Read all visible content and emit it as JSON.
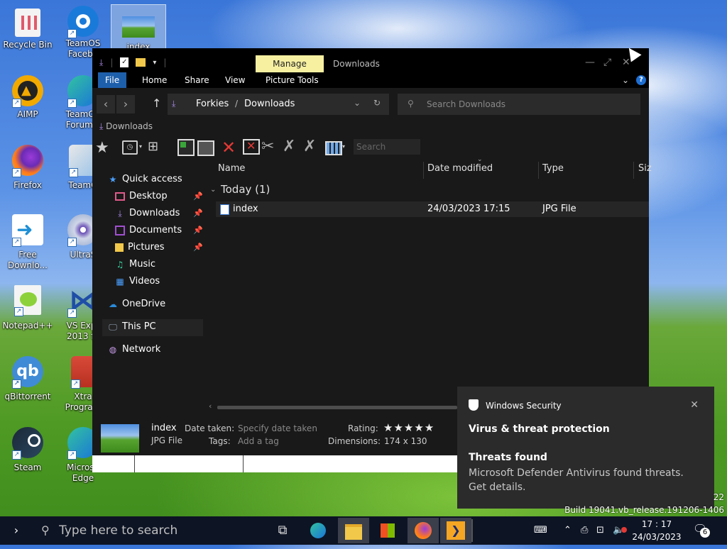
{
  "desktop": {
    "icons": [
      {
        "label": "Recycle Bin"
      },
      {
        "label": "TeamOS Facebo"
      },
      {
        "label": "index"
      },
      {
        "label": "AIMP"
      },
      {
        "label": "TeamOS Forum L"
      },
      {
        "label": "Firefox"
      },
      {
        "label": "TeamO"
      },
      {
        "label": "Free Downlo..."
      },
      {
        "label": "UltraS"
      },
      {
        "label": "Notepad++"
      },
      {
        "label": "VS Expr 2013 fo"
      },
      {
        "label": "qBittorrent"
      },
      {
        "label": "Xtra Program"
      },
      {
        "label": "Steam"
      },
      {
        "label": "Microso Edge"
      }
    ]
  },
  "explorer": {
    "manage_tab": "Manage",
    "title": "Downloads",
    "ribbon_tabs": [
      "File",
      "Home",
      "Share",
      "View",
      "Picture Tools"
    ],
    "breadcrumb": [
      "Forkies",
      "Downloads"
    ],
    "search_placeholder": "Search Downloads",
    "location_label": "Downloads",
    "toolbar_search_placeholder": "Search",
    "nav": {
      "quick_access": "Quick access",
      "items": [
        "Desktop",
        "Downloads",
        "Documents",
        "Pictures",
        "Music",
        "Videos"
      ],
      "onedrive": "OneDrive",
      "this_pc": "This PC",
      "network": "Network"
    },
    "columns": [
      "Name",
      "Date modified",
      "Type",
      "Siz"
    ],
    "group": "Today (1)",
    "files": [
      {
        "name": "index",
        "date": "24/03/2023 17:15",
        "type": "JPG File"
      }
    ],
    "details": {
      "name": "index",
      "type": "JPG File",
      "date_taken_label": "Date taken:",
      "date_taken_value": "Specify date taken",
      "tags_label": "Tags:",
      "tags_value": "Add a tag",
      "rating_label": "Rating:",
      "rating_stars": "★★★★★",
      "dimensions_label": "Dimensions:",
      "dimensions_value": "174 x 130"
    }
  },
  "toast": {
    "app": "Windows Security",
    "heading": "Virus & threat protection",
    "subheading": "Threats found",
    "body": "Microsoft Defender Antivirus found threats. Get details."
  },
  "build": {
    "line1": "22",
    "line2": "Build 19041.vb_release.191206-1406"
  },
  "taskbar": {
    "search_placeholder": "Type here to search",
    "time": "17 : 17",
    "date": "24/03/2023",
    "notification_count": "6"
  }
}
